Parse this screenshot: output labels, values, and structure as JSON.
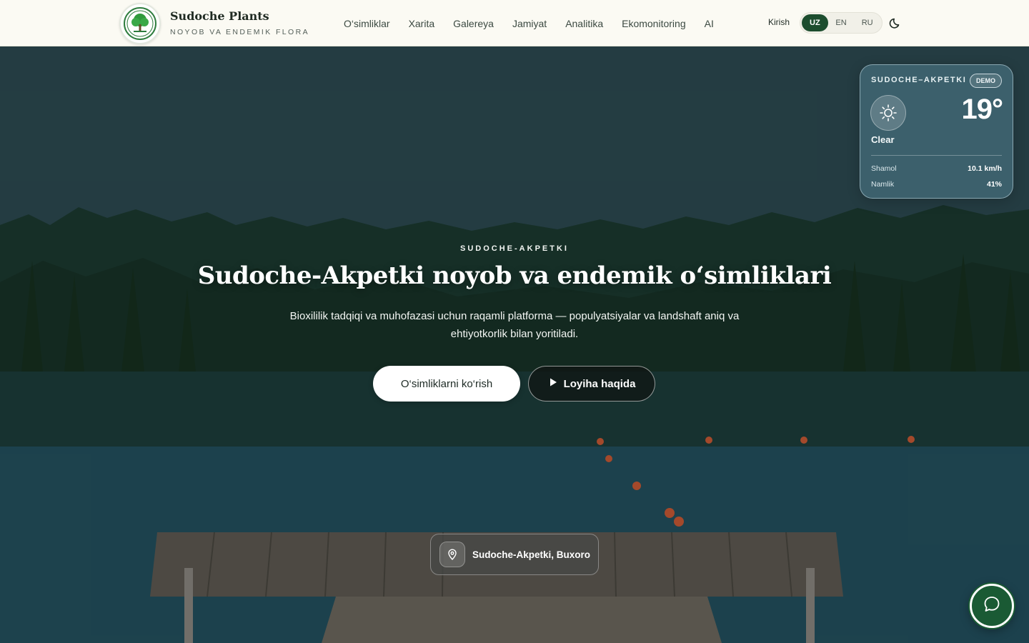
{
  "brand": {
    "title": "Sudoche Plants",
    "subtitle": "NOYOB VA ENDEMIK FLORA",
    "logo_icon": "tree-logo-icon"
  },
  "nav": {
    "items": [
      {
        "label": "O‘simliklar"
      },
      {
        "label": "Xarita"
      },
      {
        "label": "Galereya"
      },
      {
        "label": "Jamiyat"
      },
      {
        "label": "Analitika"
      },
      {
        "label": "Ekomonitoring"
      },
      {
        "label": "AI"
      }
    ],
    "login_label": "Kirish",
    "languages": [
      "UZ",
      "EN",
      "RU"
    ],
    "active_language": "UZ",
    "theme_icon": "moon-icon"
  },
  "weather": {
    "place": "SUDOCHE–AKPETKI",
    "badge": "DEMO",
    "temperature": "19°",
    "condition": "Clear",
    "wind_label": "Shamol",
    "wind_value": "10.1 km/h",
    "humidity_label": "Namlik",
    "humidity_value": "41%",
    "icon": "sun-icon"
  },
  "hero": {
    "eyebrow": "SUDOCHE-AKPETKI",
    "title": "Sudoche-Akpetki noyob va endemik o‘simliklari",
    "description": "Bioxililik tadqiqi va muhofazasi uchun raqamli platforma — populyatsiyalar va landshaft aniq va ehtiyotkorlik bilan yoritiladi.",
    "primary_button": "O‘simliklarni ko‘rish",
    "secondary_button": "Loyiha haqida",
    "location": "Sudoche-Akpetki, Buxoro"
  },
  "colors": {
    "brand_green": "#1c4d2e",
    "header_bg": "#fbfaf3",
    "chat_green": "#1a5a34"
  }
}
